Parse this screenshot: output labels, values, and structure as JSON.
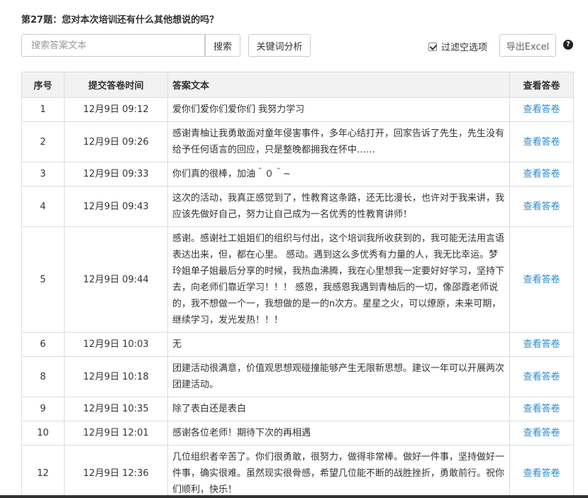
{
  "question": {
    "title": "第27题：您对本次培训还有什么其他想说的吗？"
  },
  "toolbar": {
    "search_placeholder": "搜索答案文本",
    "search_label": "搜索",
    "keyword_label": "关键词分析",
    "filter_label": "过滤空选项",
    "filter_checked": true,
    "export_label": "导出Excel",
    "help_glyph": "?"
  },
  "table": {
    "headers": {
      "index": "序号",
      "time": "提交答卷时间",
      "answer": "答案文本",
      "view": "查看答卷"
    },
    "rows": [
      {
        "index": "1",
        "time": "12月9日 09:12",
        "answer": "爱你们爱你们爱你们 我努力学习",
        "view": "查看答卷"
      },
      {
        "index": "2",
        "time": "12月9日 09:26",
        "answer": "感谢青柚让我勇敢面对童年侵害事件，多年心结打开，回家告诉了先生，先生没有给予任何语言的回应，只是整晚都拥我在怀中……",
        "view": "查看答卷"
      },
      {
        "index": "3",
        "time": "12月9日 09:33",
        "answer": "你们真的很棒，加油＾０＾~",
        "view": "查看答卷"
      },
      {
        "index": "4",
        "time": "12月9日 09:43",
        "answer": "这次的活动，我真正感觉到了，性教育这条路，还无比漫长，也许对于我来讲，我应该先做好自己，努力让自己成为一名优秀的性教育讲师！",
        "view": "查看答卷"
      },
      {
        "index": "5",
        "time": "12月9日 09:44",
        "answer": "感谢。感谢社工姐姐们的组织与付出，这个培训我所收获到的，我可能无法用言语表达出来，但，都在心里。 感动。遇到这么多优秀有力量的人，我无比幸运。梦玲姐单子姐最后分享的时候，我热血沸腾，我在心里想我一定要好好学习，坚持下去，向老师们靠近学习！！！ 感恩，我感恩我遇到青柚后的一切，像邵霞老师说的，我不想做一个一，我想做的是一的n次方。星星之火，可以燎原，未来可期，继续学习，发光发热！！！",
        "view": "查看答卷"
      },
      {
        "index": "6",
        "time": "12月9日 10:03",
        "answer": "无",
        "view": "查看答卷"
      },
      {
        "index": "8",
        "time": "12月9日 10:18",
        "answer": "团建活动很满意，价值观思想观碰撞能够产生无限新思想。建议一年可以开展两次团建活动。",
        "view": "查看答卷"
      },
      {
        "index": "9",
        "time": "12月9日 10:35",
        "answer": "除了表白还是表白",
        "view": "查看答卷"
      },
      {
        "index": "10",
        "time": "12月9日 12:01",
        "answer": "感谢各位老师！期待下次的再相遇",
        "view": "查看答卷"
      },
      {
        "index": "12",
        "time": "12月9日 12:36",
        "answer": "几位组织者辛苦了。你们很勇敢，很努力，做得非常棒。做好一件事，坚持做好一件事，确实很难。虽然现实很骨感，希望几位能不断的战胜挫折，勇敢前行。祝你们顺利，快乐！",
        "view": "查看答卷"
      }
    ]
  }
}
